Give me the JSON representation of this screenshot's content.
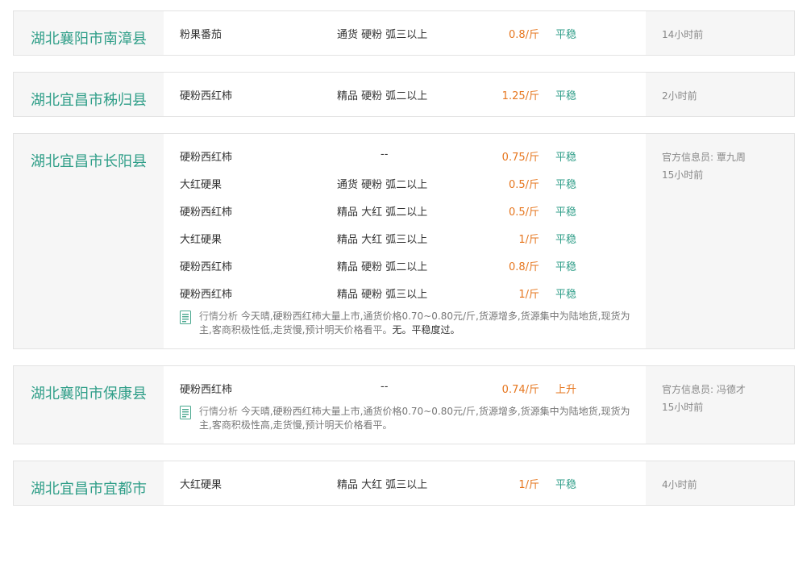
{
  "colors": {
    "region": "#2f9e88",
    "price": "#e6761e",
    "trend_stable": "#2f9e88",
    "trend_up": "#e6761e",
    "panel_bg": "#f6f6f6"
  },
  "listings": [
    {
      "region": "湖北襄阳市南漳县",
      "rows": [
        {
          "product": "粉果番茄",
          "spec": "通货 硬粉 弧三以上",
          "price": "0.8/斤",
          "trend": "平稳"
        }
      ],
      "reporter": "",
      "time": "14小时前"
    },
    {
      "region": "湖北宜昌市秭归县",
      "rows": [
        {
          "product": "硬粉西红柿",
          "spec": "精品 硬粉 弧二以上",
          "price": "1.25/斤",
          "trend": "平稳"
        }
      ],
      "reporter": "",
      "time": "2小时前"
    },
    {
      "region": "湖北宜昌市长阳县",
      "rows": [
        {
          "product": "硬粉西红柿",
          "spec": "--",
          "price": "0.75/斤",
          "trend": "平稳"
        },
        {
          "product": "大红硬果",
          "spec": "通货 硬粉 弧二以上",
          "price": "0.5/斤",
          "trend": "平稳"
        },
        {
          "product": "硬粉西红柿",
          "spec": "精品 大红 弧二以上",
          "price": "0.5/斤",
          "trend": "平稳"
        },
        {
          "product": "大红硬果",
          "spec": "精品 大红 弧三以上",
          "price": "1/斤",
          "trend": "平稳"
        },
        {
          "product": "硬粉西红柿",
          "spec": "精品 硬粉 弧二以上",
          "price": "0.8/斤",
          "trend": "平稳"
        },
        {
          "product": "硬粉西红柿",
          "spec": "精品 硬粉 弧三以上",
          "price": "1/斤",
          "trend": "平稳"
        }
      ],
      "analysis": {
        "label": "行情分析",
        "text": "今天晴,硬粉西红柿大量上市,通货价格0.70~0.80元/斤,货源增多,货源集中为陆地货,现货为主,客商积极性低,走货慢,预计明天价格看平。",
        "extra": "无。平稳度过。"
      },
      "reporter": "官方信息员: 覃九周",
      "time": "15小时前"
    },
    {
      "region": "湖北襄阳市保康县",
      "rows": [
        {
          "product": "硬粉西红柿",
          "spec": "--",
          "price": "0.74/斤",
          "trend": "上升"
        }
      ],
      "analysis": {
        "label": "行情分析",
        "text": "今天晴,硬粉西红柿大量上市,通货价格0.70~0.80元/斤,货源增多,货源集中为陆地货,现货为主,客商积极性高,走货慢,预计明天价格看平。",
        "extra": ""
      },
      "reporter": "官方信息员: 冯德才",
      "time": "15小时前"
    },
    {
      "region": "湖北宜昌市宜都市",
      "rows": [
        {
          "product": "大红硬果",
          "spec": "精品 大红 弧三以上",
          "price": "1/斤",
          "trend": "平稳"
        }
      ],
      "reporter": "",
      "time": "4小时前"
    }
  ]
}
